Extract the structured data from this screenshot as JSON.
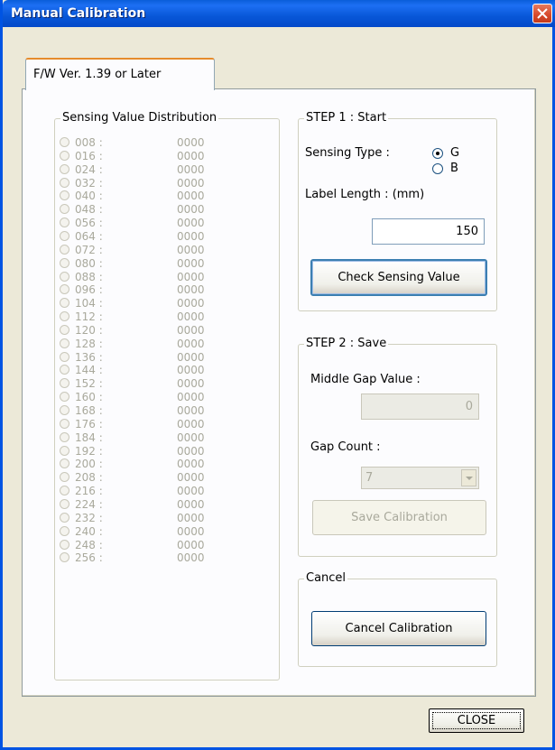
{
  "window": {
    "title": "Manual Calibration"
  },
  "tab": {
    "label": "F/W Ver. 1.39 or Later"
  },
  "distribution": {
    "legend": "Sensing Value Distribution",
    "rows": [
      {
        "label": "008 :",
        "value": "0000"
      },
      {
        "label": "016 :",
        "value": "0000"
      },
      {
        "label": "024 :",
        "value": "0000"
      },
      {
        "label": "032 :",
        "value": "0000"
      },
      {
        "label": "040 :",
        "value": "0000"
      },
      {
        "label": "048 :",
        "value": "0000"
      },
      {
        "label": "056 :",
        "value": "0000"
      },
      {
        "label": "064 :",
        "value": "0000"
      },
      {
        "label": "072 :",
        "value": "0000"
      },
      {
        "label": "080 :",
        "value": "0000"
      },
      {
        "label": "088 :",
        "value": "0000"
      },
      {
        "label": "096 :",
        "value": "0000"
      },
      {
        "label": "104 :",
        "value": "0000"
      },
      {
        "label": "112 :",
        "value": "0000"
      },
      {
        "label": "120 :",
        "value": "0000"
      },
      {
        "label": "128 :",
        "value": "0000"
      },
      {
        "label": "136 :",
        "value": "0000"
      },
      {
        "label": "144 :",
        "value": "0000"
      },
      {
        "label": "152 :",
        "value": "0000"
      },
      {
        "label": "160 :",
        "value": "0000"
      },
      {
        "label": "168 :",
        "value": "0000"
      },
      {
        "label": "176 :",
        "value": "0000"
      },
      {
        "label": "184 :",
        "value": "0000"
      },
      {
        "label": "192 :",
        "value": "0000"
      },
      {
        "label": "200 :",
        "value": "0000"
      },
      {
        "label": "208 :",
        "value": "0000"
      },
      {
        "label": "216 :",
        "value": "0000"
      },
      {
        "label": "224 :",
        "value": "0000"
      },
      {
        "label": "232 :",
        "value": "0000"
      },
      {
        "label": "240 :",
        "value": "0000"
      },
      {
        "label": "248 :",
        "value": "0000"
      },
      {
        "label": "256 :",
        "value": "0000"
      }
    ]
  },
  "step1": {
    "legend": "STEP 1 : Start",
    "sensing_type_label": "Sensing Type :",
    "option_g": "G",
    "option_b": "B",
    "selected": "G",
    "label_length_label": "Label Length : (mm)",
    "label_length_value": "150",
    "check_button": "Check Sensing Value"
  },
  "step2": {
    "legend": "STEP 2 : Save",
    "middle_gap_label": "Middle Gap Value :",
    "middle_gap_value": "0",
    "gap_count_label": "Gap Count :",
    "gap_count_value": "7",
    "save_button": "Save Calibration"
  },
  "cancel": {
    "legend": "Cancel",
    "cancel_button": "Cancel Calibration"
  },
  "footer": {
    "close_button": "CLOSE"
  },
  "colors": {
    "titlebar": "#0a5ed9",
    "tab_accent": "#e68b2c",
    "disabled_text": "#a9a99c"
  }
}
